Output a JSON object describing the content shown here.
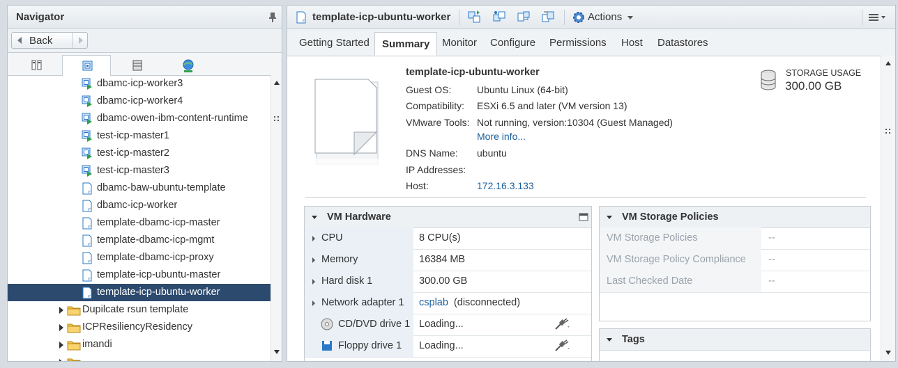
{
  "navigator": {
    "title": "Navigator",
    "back_label": "Back",
    "tabs": [
      {
        "name": "hosts-clusters-icon"
      },
      {
        "name": "vms-templates-icon",
        "active": true
      },
      {
        "name": "storage-icon"
      },
      {
        "name": "networking-icon"
      }
    ],
    "tree": [
      {
        "label": "dbamc-icp-worker3",
        "icon": "vm-powered-on-icon"
      },
      {
        "label": "dbamc-icp-worker4",
        "icon": "vm-powered-on-icon"
      },
      {
        "label": "dbamc-owen-ibm-content-runtime",
        "icon": "vm-powered-on-icon"
      },
      {
        "label": "test-icp-master1",
        "icon": "vm-powered-on-icon"
      },
      {
        "label": "test-icp-master2",
        "icon": "vm-powered-on-icon"
      },
      {
        "label": "test-icp-master3",
        "icon": "vm-powered-on-icon"
      },
      {
        "label": "dbamc-baw-ubuntu-template",
        "icon": "vm-template-icon"
      },
      {
        "label": "dbamc-icp-worker",
        "icon": "vm-template-icon"
      },
      {
        "label": "template-dbamc-icp-master",
        "icon": "vm-template-icon"
      },
      {
        "label": "template-dbamc-icp-mgmt",
        "icon": "vm-template-icon"
      },
      {
        "label": "template-dbamc-icp-proxy",
        "icon": "vm-template-icon"
      },
      {
        "label": "template-icp-ubuntu-master",
        "icon": "vm-template-icon"
      },
      {
        "label": "template-icp-ubuntu-worker",
        "icon": "vm-template-icon",
        "selected": true
      },
      {
        "label": "Dupilcate rsun template",
        "icon": "folder-icon"
      },
      {
        "label": "ICPResiliencyResidency",
        "icon": "folder-icon"
      },
      {
        "label": "imandi",
        "icon": "folder-icon"
      },
      {
        "label": "",
        "icon": "folder-icon"
      }
    ]
  },
  "main": {
    "title": "template-icp-ubuntu-worker",
    "actions_label": "Actions",
    "tabs": [
      "Getting Started",
      "Summary",
      "Monitor",
      "Configure",
      "Permissions",
      "Host",
      "Datastores"
    ],
    "active_tab": "Summary",
    "summary": {
      "name": "template-icp-ubuntu-worker",
      "guest_os_label": "Guest OS:",
      "guest_os": "Ubuntu Linux (64-bit)",
      "compat_label": "Compatibility:",
      "compat": "ESXi 6.5 and later (VM version 13)",
      "tools_label": "VMware Tools:",
      "tools": "Not running, version:10304 (Guest Managed)",
      "more_info": "More info...",
      "dns_label": "DNS Name:",
      "dns": "ubuntu",
      "ip_label": "IP Addresses:",
      "ip": "",
      "host_label": "Host:",
      "host": "172.16.3.133",
      "storage_label": "STORAGE USAGE",
      "storage_value": "300.00 GB"
    },
    "vm_hardware": {
      "title": "VM Hardware",
      "rows": [
        {
          "key": "CPU",
          "value": "8 CPU(s)"
        },
        {
          "key": "Memory",
          "value": "16384 MB"
        },
        {
          "key": "Hard disk 1",
          "value": "300.00 GB"
        },
        {
          "key": "Network adapter 1",
          "value_link": "csplab",
          "value_suffix": "(disconnected)"
        },
        {
          "key": "CD/DVD drive 1",
          "value": "Loading..."
        },
        {
          "key": "Floppy drive 1",
          "value": "Loading..."
        }
      ]
    },
    "storage_policies": {
      "title": "VM Storage Policies",
      "rows": [
        {
          "key": "VM Storage Policies",
          "value": "--"
        },
        {
          "key": "VM Storage Policy Compliance",
          "value": "--"
        },
        {
          "key": "Last Checked Date",
          "value": "--"
        }
      ]
    },
    "tags": {
      "title": "Tags"
    }
  },
  "colors": {
    "selection": "#2c4a6e",
    "link": "#1a5f9e",
    "vm_on": "#2ea24a",
    "vm_blue": "#2a78c8"
  }
}
